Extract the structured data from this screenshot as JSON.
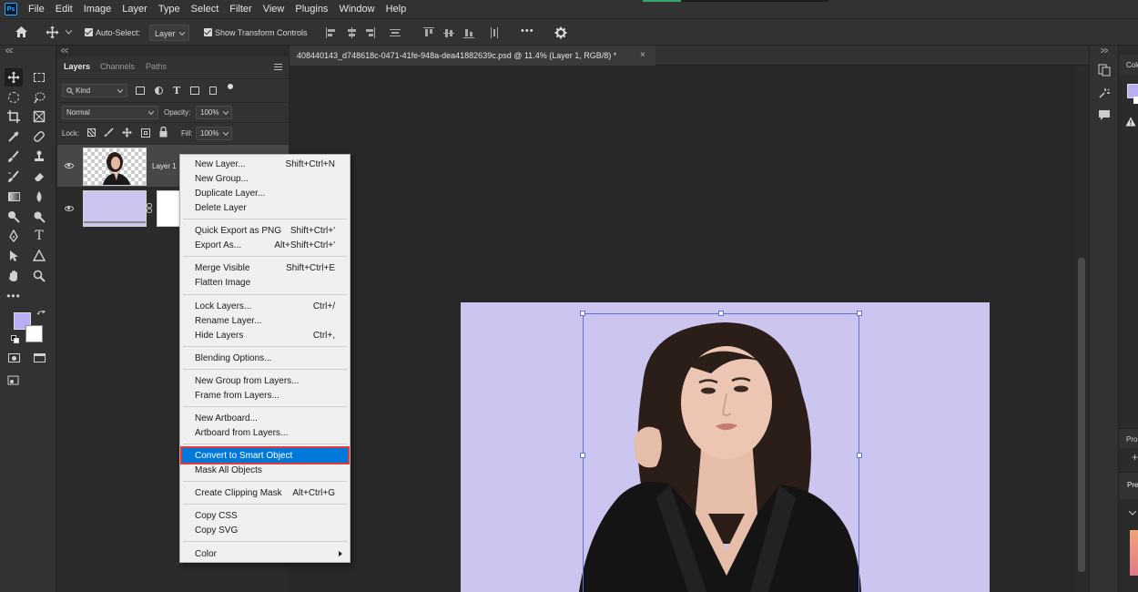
{
  "menubar": {
    "items": [
      "File",
      "Edit",
      "Image",
      "Layer",
      "Type",
      "Select",
      "Filter",
      "View",
      "Plugins",
      "Window",
      "Help"
    ]
  },
  "options": {
    "auto_select_label": "Auto-Select:",
    "auto_select_value": "Layer",
    "show_transform_label": "Show Transform Controls",
    "more_label": "•••"
  },
  "layers_panel": {
    "tabs": [
      "Layers",
      "Channels",
      "Paths"
    ],
    "kind_label": "Kind",
    "blend_mode": "Normal",
    "opacity_label": "Opacity:",
    "opacity_value": "100%",
    "lock_label": "Lock:",
    "fill_label": "Fill:",
    "fill_value": "100%",
    "layers": [
      {
        "name": "Layer 1"
      },
      {
        "name": ""
      }
    ]
  },
  "document": {
    "tab_title": "408440143_d748618c-0471-41fe-948a-dea41882639c.psd @ 11.4% (Layer 1, RGB/8) *",
    "close_glyph": "×",
    "artboard_color": "#ccc5f0"
  },
  "colors": {
    "foreground": "#b7aef3",
    "background": "#ffffff",
    "highlight": "#0078d7",
    "highlight_outline": "#e03c3c"
  },
  "context_menu": {
    "items": [
      {
        "label": "New Layer...",
        "shortcut": "Shift+Ctrl+N"
      },
      {
        "label": "New Group...",
        "shortcut": ""
      },
      {
        "label": "Duplicate Layer...",
        "shortcut": ""
      },
      {
        "label": "Delete Layer",
        "shortcut": ""
      },
      {
        "label": "Quick Export as PNG",
        "shortcut": "Shift+Ctrl+'"
      },
      {
        "label": "Export As...",
        "shortcut": "Alt+Shift+Ctrl+'"
      },
      {
        "label": "Merge Visible",
        "shortcut": "Shift+Ctrl+E"
      },
      {
        "label": "Flatten Image",
        "shortcut": ""
      },
      {
        "label": "Lock Layers...",
        "shortcut": "Ctrl+/"
      },
      {
        "label": "Rename Layer...",
        "shortcut": ""
      },
      {
        "label": "Hide Layers",
        "shortcut": "Ctrl+,"
      },
      {
        "label": "Blending Options...",
        "shortcut": ""
      },
      {
        "label": "New Group from Layers...",
        "shortcut": ""
      },
      {
        "label": "Frame from Layers...",
        "shortcut": ""
      },
      {
        "label": "New Artboard...",
        "shortcut": ""
      },
      {
        "label": "Artboard from Layers...",
        "shortcut": ""
      },
      {
        "label": "Convert to Smart Object",
        "shortcut": ""
      },
      {
        "label": "Mask All Objects",
        "shortcut": ""
      },
      {
        "label": "Create Clipping Mask",
        "shortcut": "Alt+Ctrl+G"
      },
      {
        "label": "Copy CSS",
        "shortcut": ""
      },
      {
        "label": "Copy SVG",
        "shortcut": ""
      },
      {
        "label": "Color",
        "shortcut": ""
      }
    ]
  },
  "right_panel": {
    "top_label": "Colo",
    "mid_label": "Pro",
    "low_label": "Pre"
  }
}
